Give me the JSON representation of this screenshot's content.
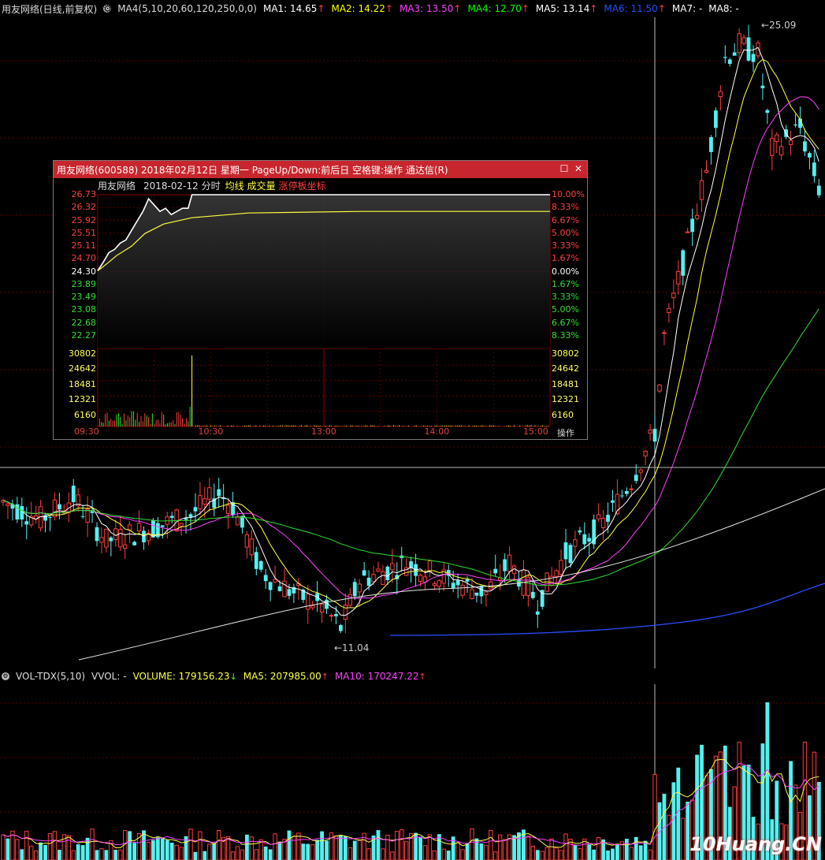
{
  "header": {
    "title": "用友网络(日线,前复权)",
    "indicator": "MA4(5,10,20,60,120,250,0,0)",
    "ma": [
      {
        "label": "MA1: 14.65",
        "color": "#ffffff",
        "arrow": "↑"
      },
      {
        "label": "MA2: 14.22",
        "color": "#ffff00",
        "arrow": "↑"
      },
      {
        "label": "MA3: 13.50",
        "color": "#ff40ff",
        "arrow": "↑"
      },
      {
        "label": "MA4: 12.70",
        "color": "#00ff00",
        "arrow": "↑"
      },
      {
        "label": "MA5: 13.14",
        "color": "#ffffff",
        "arrow": "↑"
      },
      {
        "label": "MA6: 11.50",
        "color": "#2050ff",
        "arrow": "↑"
      },
      {
        "label": "MA7: -",
        "color": "#ffffff",
        "arrow": ""
      },
      {
        "label": "MA8: -",
        "color": "#ffffff",
        "arrow": ""
      }
    ]
  },
  "main_chart": {
    "high_label": "25.09",
    "low_label": "11.04"
  },
  "volume": {
    "indicator": "VOL-TDX(5,10)",
    "vvol": "VVOL: -",
    "volume": "VOLUME: 179156.23",
    "volume_arrow": "↓",
    "ma5": "MA5: 207985.00",
    "ma5_arrow": "↑",
    "ma10": "MA10: 170247.22",
    "ma10_arrow": "↑"
  },
  "popup": {
    "title": "用友网络(600588) 2018年02月12日 星期一 PageUp/Down:前后日 空格键:操作 通达信(R)",
    "stock_name": "用友网络",
    "date_label": "2018-02-12 分时",
    "legend_avg": "均线",
    "legend_vol": "成交量",
    "legend_limit": "涨停板坐标",
    "left_prices": [
      {
        "text": "26.73",
        "color": "#ff4040"
      },
      {
        "text": "26.32",
        "color": "#ff4040"
      },
      {
        "text": "25.92",
        "color": "#ff4040"
      },
      {
        "text": "25.51",
        "color": "#ff4040"
      },
      {
        "text": "25.11",
        "color": "#ff4040"
      },
      {
        "text": "24.70",
        "color": "#ff4040"
      },
      {
        "text": "24.30",
        "color": "#ffffff"
      },
      {
        "text": "23.89",
        "color": "#30e030"
      },
      {
        "text": "23.49",
        "color": "#30e030"
      },
      {
        "text": "23.08",
        "color": "#30e030"
      },
      {
        "text": "22.68",
        "color": "#30e030"
      },
      {
        "text": "22.27",
        "color": "#30e030"
      }
    ],
    "right_pcts": [
      {
        "text": "10.00%",
        "color": "#ff4040"
      },
      {
        "text": "8.33%",
        "color": "#ff4040"
      },
      {
        "text": "6.67%",
        "color": "#ff4040"
      },
      {
        "text": "5.00%",
        "color": "#ff4040"
      },
      {
        "text": "3.33%",
        "color": "#ff4040"
      },
      {
        "text": "1.67%",
        "color": "#ff4040"
      },
      {
        "text": "0.00%",
        "color": "#ffffff"
      },
      {
        "text": "1.67%",
        "color": "#30e030"
      },
      {
        "text": "3.33%",
        "color": "#30e030"
      },
      {
        "text": "5.00%",
        "color": "#30e030"
      },
      {
        "text": "6.67%",
        "color": "#30e030"
      },
      {
        "text": "8.33%",
        "color": "#30e030"
      }
    ],
    "vol_labels": [
      "30802",
      "24642",
      "18481",
      "12321",
      "6160"
    ],
    "time_labels": [
      "09:30",
      "10:30",
      "13:00",
      "14:00",
      "15:00"
    ],
    "ops_label": "操作"
  },
  "watermark": "10Huang.CN"
}
